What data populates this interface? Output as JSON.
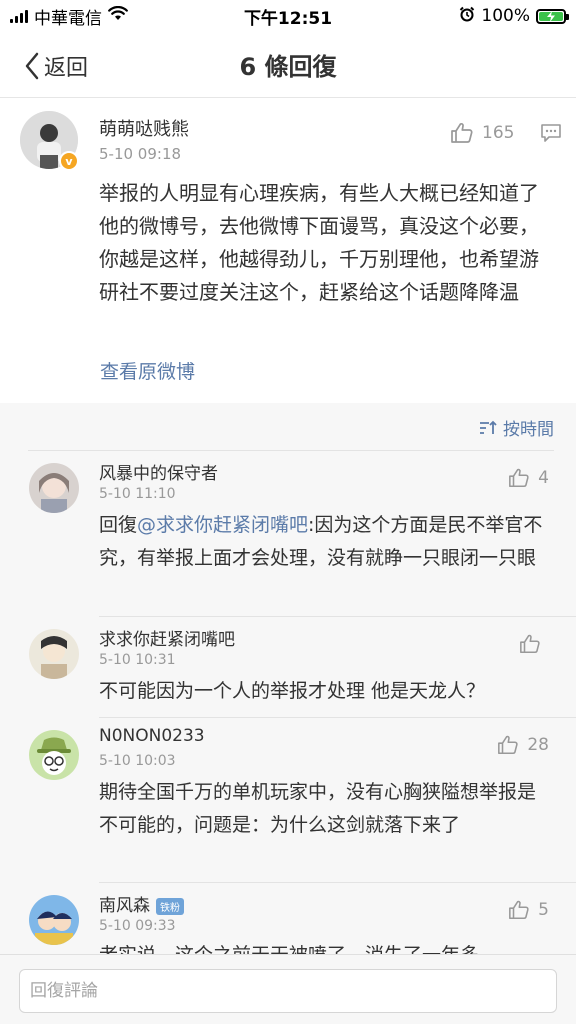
{
  "status_bar": {
    "carrier": "中華電信",
    "time": "下午12:51",
    "battery": "100%"
  },
  "nav": {
    "back_label": "返回",
    "title": "6 條回復"
  },
  "main_comment": {
    "username": "萌萌哒贱熊",
    "verified_badge": "v",
    "time": "5-10 09:18",
    "likes": "165",
    "text": "举报的人明显有心理疾病，有些人大概已经知道了他的微博号，去他微博下面谩骂，真没这个必要，你越是这样，他越得劲儿，千万别理他，也希望游研社不要过度关注这个，赶紧给这个话题降降温",
    "view_origin": "查看原微博"
  },
  "sort": {
    "label": "按時間"
  },
  "replies": [
    {
      "username": "风暴中的保守者",
      "time": "5-10 11:10",
      "likes": "4",
      "prefix": "回復",
      "mention": "@求求你赶紧闭嘴吧",
      "text": ":因为这个方面是民不举官不究，有举报上面才会处理，没有就睁一只眼闭一只眼"
    },
    {
      "username": "求求你赶紧闭嘴吧",
      "time": "5-10 10:31",
      "likes": "",
      "text": "不可能因为一个人的举报才处理 他是天龙人？"
    },
    {
      "username": "N0NON0233",
      "time": "5-10 10:03",
      "likes": "28",
      "text": "期待全国千万的单机玩家中，没有心胸狭隘想举报是不可能的，问题是：为什么这剑就落下来了"
    },
    {
      "username": "南风森",
      "badge": "铁粉",
      "time": "5-10 09:33",
      "likes": "5",
      "text": "老实说，这个之前天天被喷了，消失了一年多"
    }
  ],
  "bottom": {
    "placeholder": "回復評論"
  },
  "colors": {
    "link": "#5b7ba9",
    "verified": "#f5a623",
    "battery": "#3cc24b"
  },
  "icons": [
    "signal-icon",
    "wifi-icon",
    "alarm-icon",
    "battery-icon",
    "back-chevron-icon",
    "thumb-up-icon",
    "comment-icon",
    "sort-icon"
  ]
}
